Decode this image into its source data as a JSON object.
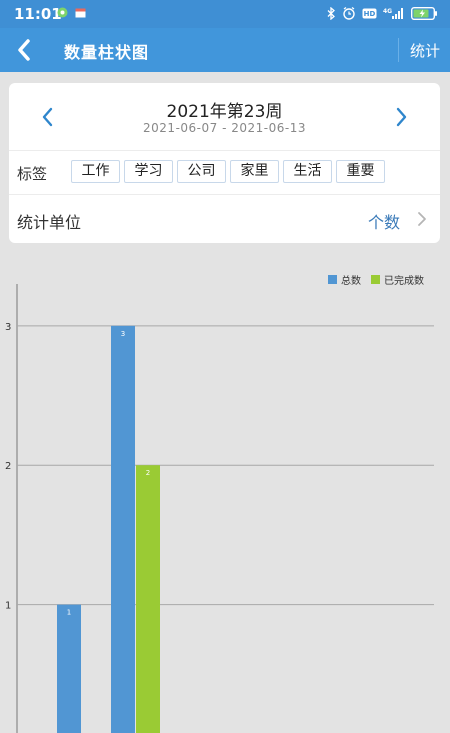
{
  "status_bar": {
    "time": "11:01",
    "icons": [
      "sim-icon",
      "calendar-icon",
      "bluetooth-icon",
      "alarm-icon",
      "hd-icon",
      "4g-signal-icon",
      "battery-charging-icon"
    ]
  },
  "header": {
    "title": "数量柱状图",
    "action_label": "统计",
    "back_icon": "chevron-left-icon",
    "color": "#4196db"
  },
  "week_selector": {
    "title": "2021年第23周",
    "range": "2021-06-07 - 2021-06-13"
  },
  "tags": {
    "label": "标签",
    "items": [
      "工作",
      "学习",
      "公司",
      "家里",
      "生活",
      "重要"
    ]
  },
  "unit": {
    "label": "统计单位",
    "value": "个数"
  },
  "chart_data": {
    "type": "bar",
    "categories": [
      "",
      ""
    ],
    "series": [
      {
        "name": "总数",
        "values": [
          1,
          3
        ],
        "color": "#5196d3"
      },
      {
        "name": "已完成数",
        "values": [
          null,
          2
        ],
        "color": "#9acb34"
      }
    ],
    "ylim": [
      0,
      3.3
    ],
    "yticks": [
      1,
      2,
      3
    ],
    "grid": true,
    "legend": "top-right",
    "data_labels": true
  }
}
